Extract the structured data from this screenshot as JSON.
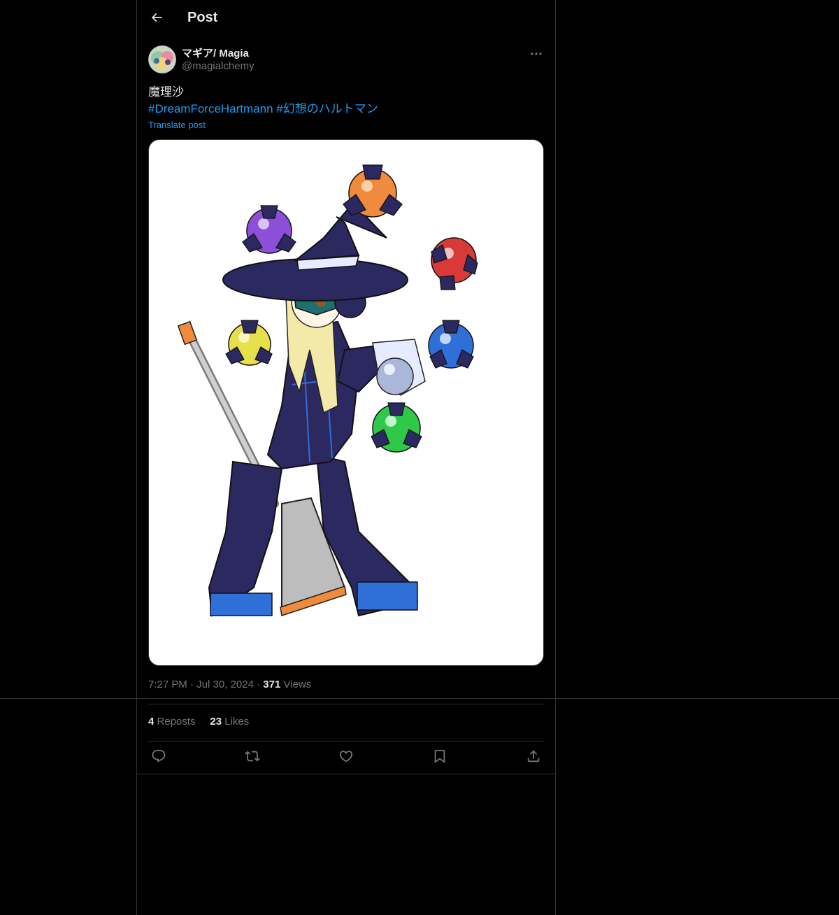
{
  "header": {
    "title": "Post",
    "back_icon": "arrow-left-icon"
  },
  "author": {
    "display_name": "マギア/ Magia",
    "handle": "@magialchemy"
  },
  "post": {
    "text": "魔理沙",
    "hashtags": [
      "#DreamForceHartmann",
      "#幻想のハルトマン"
    ],
    "translate_label": "Translate post",
    "image_icon": "witch-robot-illustration"
  },
  "meta": {
    "time": "7:27 PM",
    "separator": "·",
    "date": "Jul 30, 2024",
    "views_count": "371",
    "views_label": "Views"
  },
  "stats": {
    "reposts_count": "4",
    "reposts_label": "Reposts",
    "likes_count": "23",
    "likes_label": "Likes"
  },
  "actions": {
    "icons": [
      "reply-icon",
      "repost-icon",
      "like-icon",
      "bookmark-icon",
      "share-icon"
    ]
  },
  "colors": {
    "background": "#000000",
    "text_primary": "#e7e9ea",
    "text_secondary": "#71767b",
    "accent": "#1d9bf0",
    "border": "#2f3336"
  }
}
